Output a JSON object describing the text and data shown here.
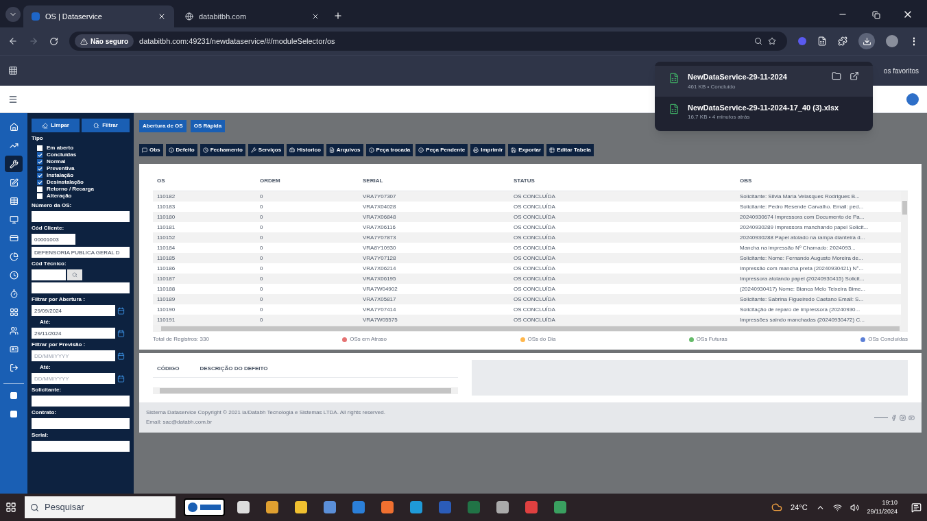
{
  "browser": {
    "tabs": [
      {
        "title": "OS | Dataservice",
        "selected": true
      },
      {
        "title": "databitbh.com",
        "selected": false
      }
    ],
    "security": "Não seguro",
    "menu_glyph": "⋮",
    "url": "databitbh.com:49231/newdataservice/#/moduleSelector/os",
    "bookmarks_right": "os favoritos"
  },
  "downloads": [
    {
      "name": "NewDataService-29-11-2024",
      "info": "461 KB • Concluído",
      "kind": "actions"
    },
    {
      "name": "NewDataService-29-11-2024-17_40 (3).xlsx",
      "info": "16,7 KB • 4 minutos atrás",
      "kind": "plain"
    }
  ],
  "nav_rail": [
    {
      "selected": false
    },
    {
      "selected": false
    },
    {
      "selected": true
    },
    {
      "selected": false
    },
    {
      "selected": false
    },
    {
      "selected": false
    },
    {
      "selected": false
    },
    {
      "selected": false
    },
    {
      "selected": false
    },
    {
      "selected": false
    },
    {
      "selected": false
    },
    {
      "selected": false
    },
    {
      "selected": false
    },
    {
      "selected": false
    }
  ],
  "filters": {
    "clear_button": "Limpar",
    "filter_button": "Filtrar",
    "type_label": "Tipo",
    "types": [
      {
        "label": "Em aberto",
        "checked": false
      },
      {
        "label": "Concluídas",
        "checked": true
      },
      {
        "label": "Normal",
        "checked": true
      },
      {
        "label": "Preventiva",
        "checked": true
      },
      {
        "label": "Instalação",
        "checked": true
      },
      {
        "label": "Desinstalação",
        "checked": true
      },
      {
        "label": "Retorno / Recarga",
        "checked": false
      },
      {
        "label": "Alteração",
        "checked": false
      }
    ],
    "fields": [
      {
        "kind": "text",
        "label": "Número da OS:"
      },
      {
        "kind": "short",
        "label": "Cód Cliente:",
        "value": "00001003"
      },
      {
        "kind": "readonly",
        "value": "DEFENSORIA PUBLICA GERAL D"
      },
      {
        "kind": "search",
        "label": "Cód Técnico:"
      },
      {
        "kind": "readonly"
      },
      {
        "kind": "date",
        "label": "Filtrar por Abertura :",
        "value": "29/09/2024"
      },
      {
        "kind": "date",
        "label": "Até:",
        "sub": true,
        "value": "29/11/2024"
      },
      {
        "kind": "date",
        "label": "Filtrar por Previsão :",
        "placeholder": "DD/MM/YYYY"
      },
      {
        "kind": "date",
        "label": "Até:",
        "sub": true,
        "placeholder": "DD/MM/YYYY"
      },
      {
        "kind": "text",
        "label": "Solicitante:"
      },
      {
        "kind": "text",
        "label": "Contrato:"
      },
      {
        "kind": "text",
        "label": "Serial:"
      }
    ]
  },
  "top_buttons": [
    "Abertura de OS",
    "OS Rápida"
  ],
  "toolbar": [
    "Obs",
    "Defeito",
    "Fechamento",
    "Serviços",
    "Historico",
    "Arquivos",
    "Peça trocada",
    "Peça Pendente",
    "Imprimir",
    "Exportar",
    "Editar Tabela"
  ],
  "table": {
    "columns": [
      "OS",
      "ORDEM",
      "SERIAL",
      "STATUS",
      "OBS"
    ],
    "rows": [
      [
        "110182",
        "0",
        "VRA7Y07307",
        "OS CONCLUÍDA",
        "Solicitante: Silvia Maria Velasques Rodrigues B..."
      ],
      [
        "110183",
        "0",
        "VRA7X04028",
        "OS CONCLUÍDA",
        "Solicitante: Pedro Resende Carvalho. Email: ped..."
      ],
      [
        "110180",
        "0",
        "VRA7X06848",
        "OS CONCLUÍDA",
        "20240930674 Impressora com Documento de Pa..."
      ],
      [
        "110181",
        "0",
        "VRA7X06116",
        "OS CONCLUÍDA",
        "20240930289 Impressora manchando papel Solicit..."
      ],
      [
        "110152",
        "0",
        "VRA7Y07873",
        "OS CONCLUÍDA",
        "20240930288 Papel atolado na rampa dianteira d..."
      ],
      [
        "110184",
        "0",
        "VRA8Y10930",
        "OS CONCLUÍDA",
        "Mancha na impressão Nº Chamado: 2024093..."
      ],
      [
        "110185",
        "0",
        "VRA7Y07128",
        "OS CONCLUÍDA",
        "Solicitante: Nome: Fernando Augusto Moreira de..."
      ],
      [
        "110186",
        "0",
        "VRA7X06214",
        "OS CONCLUÍDA",
        "Impressão com mancha preta (20240930421) N°..."
      ],
      [
        "110187",
        "0",
        "VRA7X06195",
        "OS CONCLUÍDA",
        "Impressora atolando papel (20240930415) Solicit..."
      ],
      [
        "110188",
        "0",
        "VRA7W04902",
        "OS CONCLUÍDA",
        "(20240930417) Nome: Bianca Melo Teixeira Bime..."
      ],
      [
        "110189",
        "0",
        "VRA7X05817",
        "OS CONCLUÍDA",
        "Solicitante: Sabrina Figueiredo Caetano Email: S..."
      ],
      [
        "110190",
        "0",
        "VRA7Y07414",
        "OS CONCLUÍDA",
        "Solicitação de reparo de impressora (20240930..."
      ],
      [
        "110191",
        "0",
        "VRA7W05575",
        "OS CONCLUÍDA",
        "Impressões saindo manchadas (20240930472) C..."
      ]
    ],
    "total": "Total de Registros: 330",
    "legend": [
      {
        "label": "OSs em Atraso",
        "color": "#e57373"
      },
      {
        "label": "OSs do Dia",
        "color": "#ffb74d"
      },
      {
        "label": "OSs Futuras",
        "color": "#66bb6a"
      },
      {
        "label": "OSs Concluídas",
        "color": "#5c7fd6"
      }
    ]
  },
  "defects": {
    "columns": [
      "CÓDIGO",
      "DESCRIÇÃO DO DEFEITO"
    ]
  },
  "footer": {
    "copyright": "Sistema Dataservice Copyright © 2021 ia/Databh Tecnologia e Sistemas LTDA. All rights reserved.",
    "email": "Email: sac@databh.com.br"
  },
  "taskbar": {
    "search": "Pesquisar",
    "weather": "24°C",
    "time": "19:10",
    "date": "29/11/2024"
  }
}
